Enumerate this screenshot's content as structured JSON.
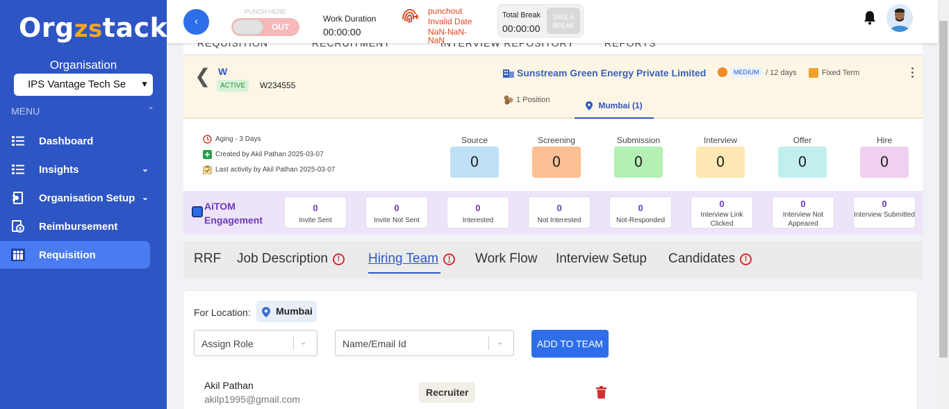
{
  "sidebar": {
    "logo": {
      "part1": "Org",
      "part2": "zs",
      "part3": "tack"
    },
    "org_label": "Organisation",
    "org_selected": "IPS Vantage Tech Se",
    "menu_label": "MENU",
    "items": [
      {
        "label": "Dashboard",
        "icon": "list-icon"
      },
      {
        "label": "Insights",
        "icon": "list-icon"
      },
      {
        "label": "Organisation Setup",
        "icon": "setup-icon"
      },
      {
        "label": "Reimbursement",
        "icon": "reimbursement-icon"
      },
      {
        "label": "Requisition",
        "icon": "people-icon"
      }
    ]
  },
  "topbar": {
    "punch_label": "PUNCH HERE",
    "punch_state": "OUT",
    "work_duration_label": "Work Duration",
    "work_duration_time": "00:00:00",
    "punch_status_line1": "punchout",
    "punch_status_line2": "Invalid Date",
    "punch_status_line3": "NaN-NaN-",
    "punch_status_line4": "NaN",
    "total_break_label": "Total Break",
    "total_break_time": "00:00:00",
    "take_break_label": "TAKE A BREAK"
  },
  "section_tabs": [
    "REQUISITION",
    "RECRUITMENT",
    "INTERVIEW REPOSITORY",
    "REPORTS"
  ],
  "requisition": {
    "title": "W",
    "status": "ACTIVE",
    "code": "W234555",
    "company": "Sunstream Green Energy Private Limited",
    "priority": "MEDIUM",
    "days": "/ 12 days",
    "term": "Fixed Term",
    "positions": "1 Position",
    "location_tab": "Mumbai (1)"
  },
  "meta": {
    "aging": "Aging - 3 Days",
    "created": "Created by Akil Pathan 2025-03-07",
    "last_activity": "Last activity by Akil Pathan 2025-03-07"
  },
  "stages": [
    {
      "label": "Source",
      "value": "0",
      "color": "#bfe1f6"
    },
    {
      "label": "Screening",
      "value": "0",
      "color": "#fbbf94"
    },
    {
      "label": "Submission",
      "value": "0",
      "color": "#b4f0b4"
    },
    {
      "label": "Interview",
      "value": "0",
      "color": "#fde8b3"
    },
    {
      "label": "Offer",
      "value": "0",
      "color": "#c0efee"
    },
    {
      "label": "Hire",
      "value": "0",
      "color": "#f0d0f0"
    }
  ],
  "aitom": {
    "title_line1": "AiTOM",
    "title_line2": "Engagement",
    "items": [
      {
        "value": "0",
        "label": "Invite Sent"
      },
      {
        "value": "0",
        "label": "Invite Not Sent"
      },
      {
        "value": "0",
        "label": "Interested"
      },
      {
        "value": "0",
        "label": "Not Interested"
      },
      {
        "value": "0",
        "label": "Not-Responded"
      },
      {
        "value": "0",
        "label": "Interview Link Clicked"
      },
      {
        "value": "0",
        "label": "Interview Not Appeared"
      },
      {
        "value": "0",
        "label": "Interview Submitted"
      }
    ]
  },
  "tabs": [
    {
      "label": "RRF"
    },
    {
      "label": "Job Description"
    },
    {
      "label": "Hiring Team"
    },
    {
      "label": "Work Flow"
    },
    {
      "label": "Interview Setup"
    },
    {
      "label": "Candidates"
    }
  ],
  "hiring_team": {
    "for_location_label": "For Location:",
    "location": "Mumbai",
    "role_placeholder": "Assign Role",
    "name_placeholder": "Name/Email Id",
    "add_button": "ADD TO TEAM",
    "members": [
      {
        "name": "Akil Pathan",
        "email": "akilp1995@gmail.com",
        "role": "Recruiter"
      }
    ]
  }
}
